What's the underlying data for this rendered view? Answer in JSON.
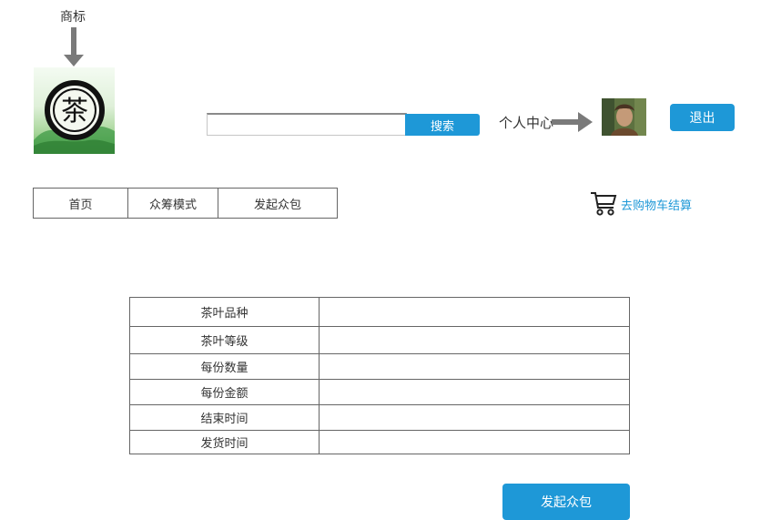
{
  "header": {
    "logo_caption": "商标",
    "logo_glyph": "茶",
    "search": {
      "placeholder": "",
      "value": "",
      "button_label": "搜索"
    },
    "personal_center_label": "个人中心",
    "logout_label": "退出"
  },
  "nav": {
    "items": [
      {
        "label": "首页"
      },
      {
        "label": "众筹模式"
      },
      {
        "label": "发起众包"
      }
    ]
  },
  "cart": {
    "label": "去购物车结算",
    "icon": "shopping-cart-icon"
  },
  "form": {
    "rows": [
      {
        "label": "茶叶品种",
        "value": ""
      },
      {
        "label": "茶叶等级",
        "value": ""
      },
      {
        "label": "每份数量",
        "value": ""
      },
      {
        "label": "每份金额",
        "value": ""
      },
      {
        "label": "结束时间",
        "value": ""
      },
      {
        "label": "发货时间",
        "value": ""
      }
    ],
    "submit_label": "发起众包"
  },
  "colors": {
    "accent": "#1e98d7",
    "arrow": "#7a7a7a",
    "border": "#666666"
  }
}
